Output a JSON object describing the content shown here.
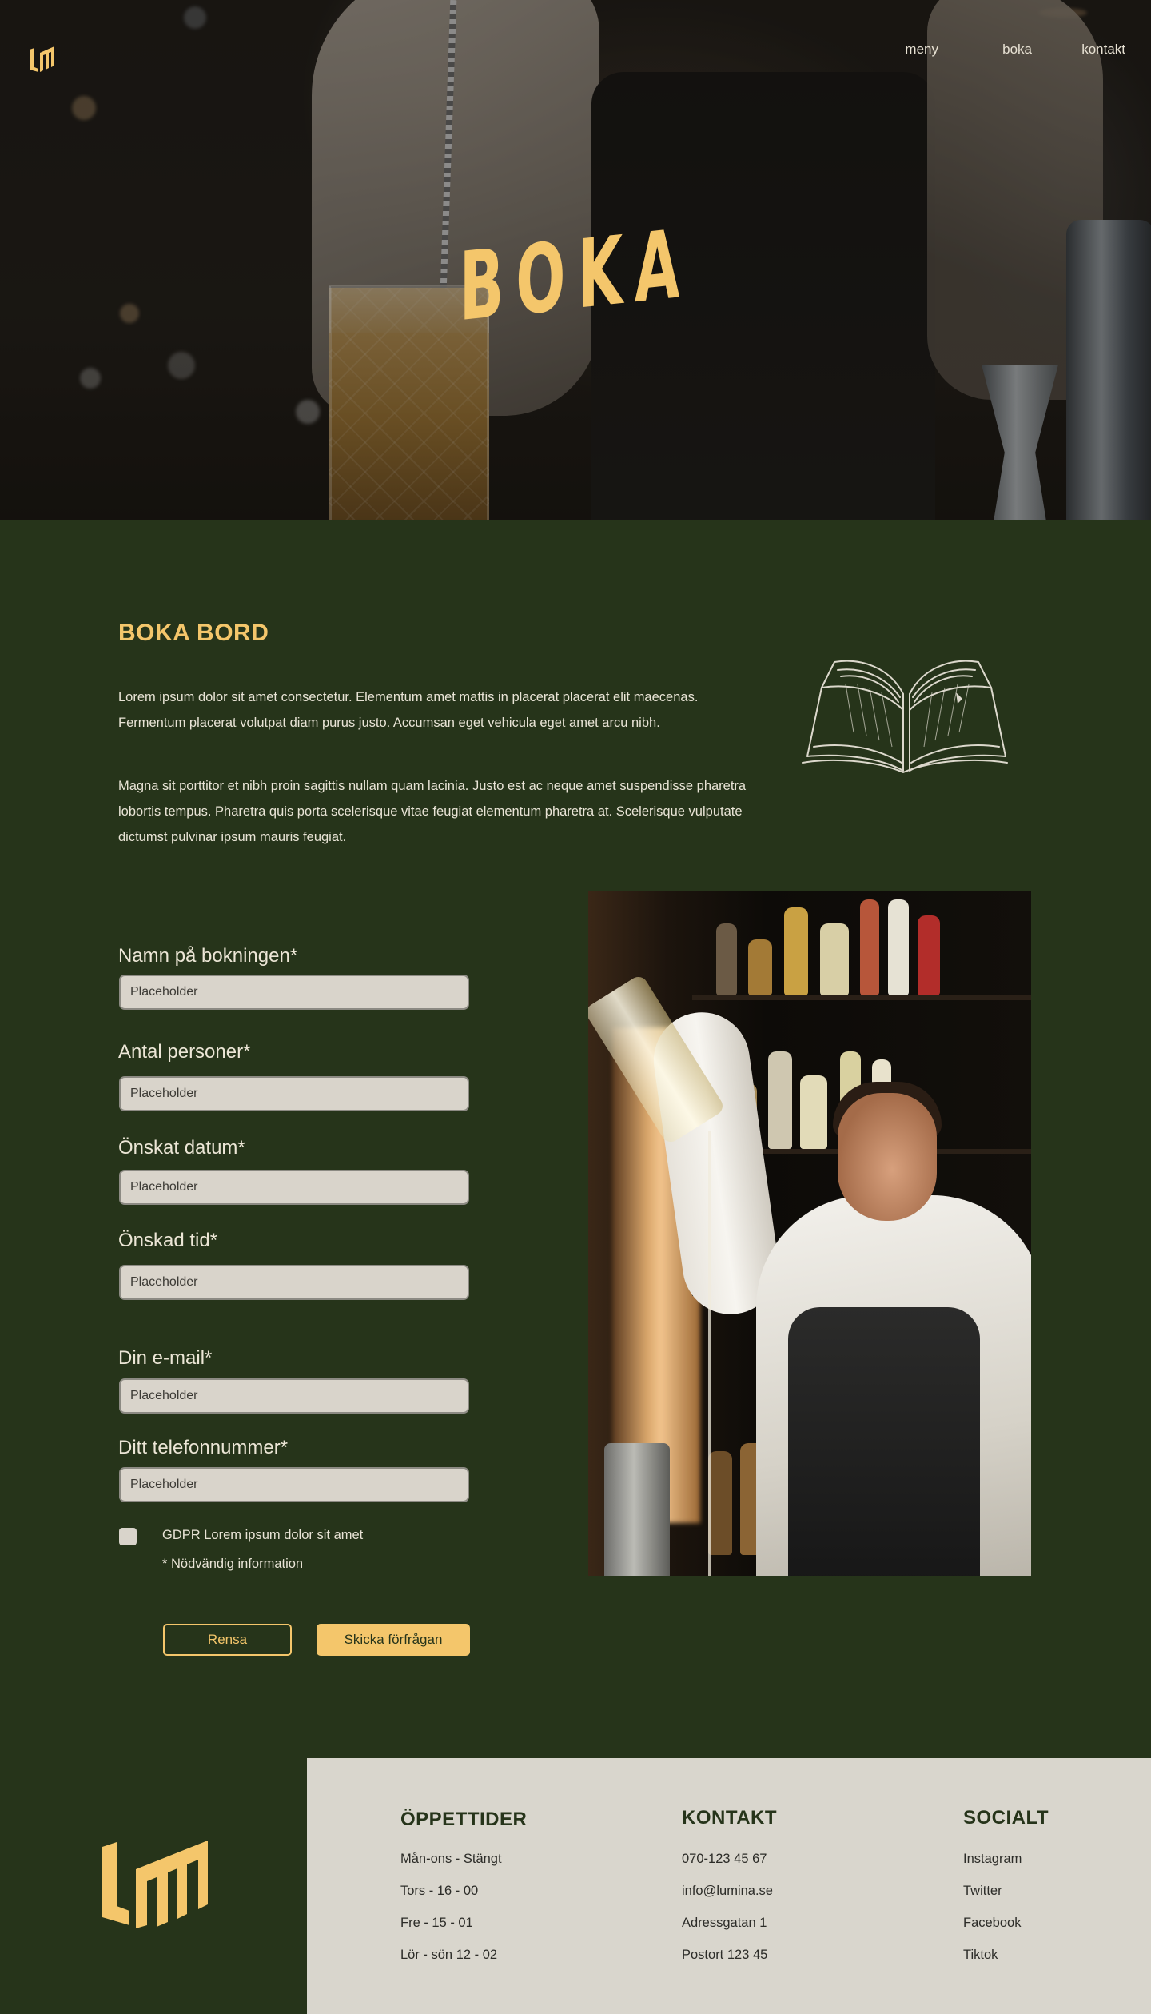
{
  "nav": {
    "items": [
      {
        "label": "meny"
      },
      {
        "label": "boka"
      },
      {
        "label": "kontakt"
      }
    ]
  },
  "hero": {
    "title": "BOKA"
  },
  "intro": {
    "title": "BOKA BORD",
    "paragraph1": "Lorem ipsum dolor sit amet consectetur. Elementum amet mattis in placerat placerat elit maecenas. Fermentum placerat volutpat diam purus justo. Accumsan eget vehicula eget amet arcu nibh.",
    "paragraph2": "Magna sit porttitor et nibh proin sagittis nullam quam lacinia. Justo est ac neque amet suspendisse pharetra lobortis tempus. Pharetra quis porta scelerisque vitae feugiat elementum pharetra at. Scelerisque vulputate dictumst pulvinar ipsum mauris feugiat."
  },
  "form": {
    "fields": [
      {
        "label": "Namn på bokningen*",
        "placeholder": "Placeholder",
        "value": ""
      },
      {
        "label": "Antal personer*",
        "placeholder": "Placeholder",
        "value": ""
      },
      {
        "label": "Önskat datum*",
        "placeholder": "Placeholder",
        "value": ""
      },
      {
        "label": "Önskad tid*",
        "placeholder": "Placeholder",
        "value": ""
      },
      {
        "label": "Din e-mail*",
        "placeholder": "Placeholder",
        "value": ""
      },
      {
        "label": "Ditt telefonnummer*",
        "placeholder": "Placeholder",
        "value": ""
      }
    ],
    "gdpr_label": "GDPR Lorem ipsum dolor sit amet",
    "gdpr_checked": false,
    "required_note": "* Nödvändig information",
    "reset_label": "Rensa",
    "submit_label": "Skicka förfrågan"
  },
  "footer": {
    "hours": {
      "heading": "ÖPPETTIDER",
      "lines": [
        "Mån-ons - Stängt",
        "Tors - 16 - 00",
        "Fre - 15 - 01",
        "Lör - sön 12 - 02"
      ]
    },
    "contact": {
      "heading": "KONTAKT",
      "lines": [
        "070-123 45 67",
        "info@lumina.se",
        "Adressgatan 1",
        "Postort 123 45"
      ]
    },
    "social": {
      "heading": "SOCIALT",
      "links": [
        "Instagram ",
        "Twitter",
        "Facebook",
        "Tiktok"
      ]
    }
  },
  "colors": {
    "background": "#26341a",
    "accent": "#f4c66b",
    "footer_panel": "#d9d6cd",
    "input_bg": "#d9d4cb"
  },
  "icons": {
    "logo": "lm-monogram-logo",
    "illustration": "open-book-illustration"
  }
}
